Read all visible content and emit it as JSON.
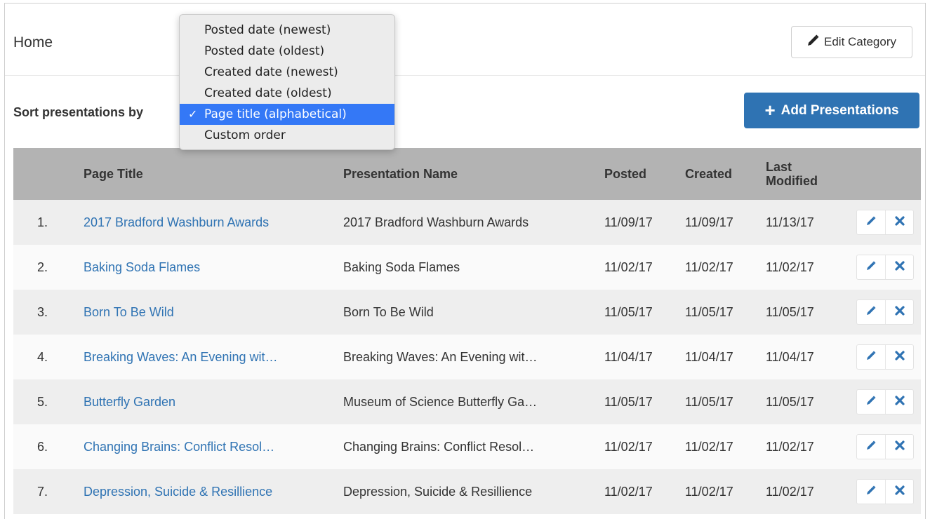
{
  "header": {
    "title": "Home",
    "edit_category_label": "Edit Category"
  },
  "sort": {
    "label": "Sort presentations by",
    "options": [
      "Posted date (newest)",
      "Posted date (oldest)",
      "Created date (newest)",
      "Created date (oldest)",
      "Page title (alphabetical)",
      "Custom order"
    ],
    "selected_index": 4,
    "check_glyph": "✓"
  },
  "add_button": {
    "label": "Add Presentations",
    "icon": "plus-icon"
  },
  "table": {
    "columns": [
      "",
      "Page Title",
      "Presentation Name",
      "Posted",
      "Created",
      "Last Modified"
    ],
    "last_modified_lines": [
      "Last",
      "Modified"
    ],
    "rows": [
      {
        "num": "1.",
        "title": "2017 Bradford Washburn Awards",
        "presentation": "2017 Bradford Washburn Awards",
        "posted": "11/09/17",
        "created": "11/09/17",
        "modified": "11/13/17"
      },
      {
        "num": "2.",
        "title": "Baking Soda Flames",
        "presentation": "Baking Soda Flames",
        "posted": "11/02/17",
        "created": "11/02/17",
        "modified": "11/02/17"
      },
      {
        "num": "3.",
        "title": "Born To Be Wild",
        "presentation": "Born To Be Wild",
        "posted": "11/05/17",
        "created": "11/05/17",
        "modified": "11/05/17"
      },
      {
        "num": "4.",
        "title": "Breaking Waves: An Evening wit…",
        "presentation": "Breaking Waves: An Evening wit…",
        "posted": "11/04/17",
        "created": "11/04/17",
        "modified": "11/04/17"
      },
      {
        "num": "5.",
        "title": "Butterfly Garden",
        "presentation": "Museum of Science Butterfly Ga…",
        "posted": "11/05/17",
        "created": "11/05/17",
        "modified": "11/05/17"
      },
      {
        "num": "6.",
        "title": "Changing Brains: Conflict Resol…",
        "presentation": "Changing Brains: Conflict Resol…",
        "posted": "11/02/17",
        "created": "11/02/17",
        "modified": "11/02/17"
      },
      {
        "num": "7.",
        "title": "Depression, Suicide & Resillience",
        "presentation": "Depression, Suicide & Resillience",
        "posted": "11/02/17",
        "created": "11/02/17",
        "modified": "11/02/17"
      }
    ]
  },
  "colors": {
    "link": "#2f73b3",
    "primary_button": "#2f73b3",
    "header_row": "#b3b3b3",
    "selected_option": "#3478f6"
  },
  "icons": {
    "edit": "pencil-icon",
    "delete": "close-icon"
  }
}
